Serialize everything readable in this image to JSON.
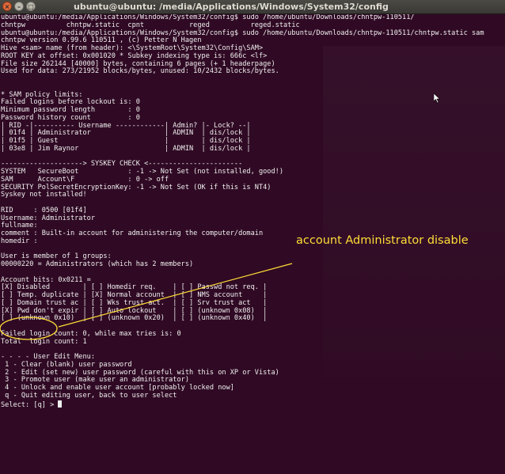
{
  "window": {
    "title": "ubuntu@ubuntu: /media/Applications/Windows/System32/config",
    "close_glyph": "×",
    "minimize_glyph": "–",
    "maximize_glyph": "□"
  },
  "annotation": {
    "text": "account Administrator disable",
    "color": "#ffdd37"
  },
  "colors": {
    "terminal_bg": "#300a24",
    "text": "#f0f0f0",
    "highlight": "#ffdd37"
  },
  "terminal": {
    "lines": [
      "ubuntu@ubuntu:/media/Applications/Windows/System32/config$ sudo /home/ubuntu/Downloads/chntpw-110511/",
      "chntpw          chntpw.static  cpnt           reged          reged.static",
      "ubuntu@ubuntu:/media/Applications/Windows/System32/config$ sudo /home/ubuntu/Downloads/chntpw-110511/chntpw.static sam",
      "chntpw version 0.99.6 110511 , (c) Petter N Hagen",
      "Hive <sam> name (from header): <\\SystemRoot\\System32\\Config\\SAM>",
      "ROOT KEY at offset: 0x001020 * Subkey indexing type is: 666c <lf>",
      "File size 262144 [40000] bytes, containing 6 pages (+ 1 headerpage)",
      "Used for data: 273/21952 blocks/bytes, unused: 10/2432 blocks/bytes.",
      "",
      "",
      "* SAM policy limits:",
      "Failed logins before lockout is: 0",
      "Minimum password length        : 0",
      "Password history count         : 0",
      "| RID -|---------- Username ------------| Admin? |- Lock? --|",
      "| 01f4 | Administrator                  | ADMIN  | dis/lock |",
      "| 01f5 | Guest                          |        | dis/lock |",
      "| 03e8 | Jim Raynor                     | ADMIN  | dis/lock |",
      "",
      "--------------------> SYSKEY CHECK <-----------------------",
      "SYSTEM   SecureBoot            : -1 -> Not Set (not installed, good!)",
      "SAM      Account\\F             : 0 -> off",
      "SECURITY PolSecretEncryptionKey: -1 -> Not Set (OK if this is NT4)",
      "Syskey not installed!",
      "",
      "RID     : 0500 [01f4]",
      "Username: Administrator",
      "fullname:",
      "comment : Built-in account for administering the computer/domain",
      "homedir :",
      "",
      "User is member of 1 groups:",
      "00000220 = Administrators (which has 2 members)",
      "",
      "Account bits: 0x0211 =",
      "[X] Disabled        | [ ] Homedir req.    | [ ] Passwd not req. |",
      "[ ] Temp. duplicate | [X] Normal account  | [ ] NMS account     |",
      "[ ] Domain trust ac | [ ] Wks trust act.  | [ ] Srv trust act   |",
      "[X] Pwd don't expir | [ ] Auto lockout    | [ ] (unknown 0x08)  |",
      "[ ] (unknown 0x10)  | [ ] (unknown 0x20)  | [ ] (unknown 0x40)  |",
      "",
      "Failed login count: 0, while max tries is: 0",
      "Total  login count: 1",
      "",
      "- - - - User Edit Menu:",
      " 1 - Clear (blank) user password",
      " 2 - Edit (set new) user password (careful with this on XP or Vista)",
      " 3 - Promote user (make user an administrator)",
      " 4 - Unlock and enable user account [probably locked now]",
      " q - Quit editing user, back to user select",
      "Select: [q] > "
    ]
  }
}
